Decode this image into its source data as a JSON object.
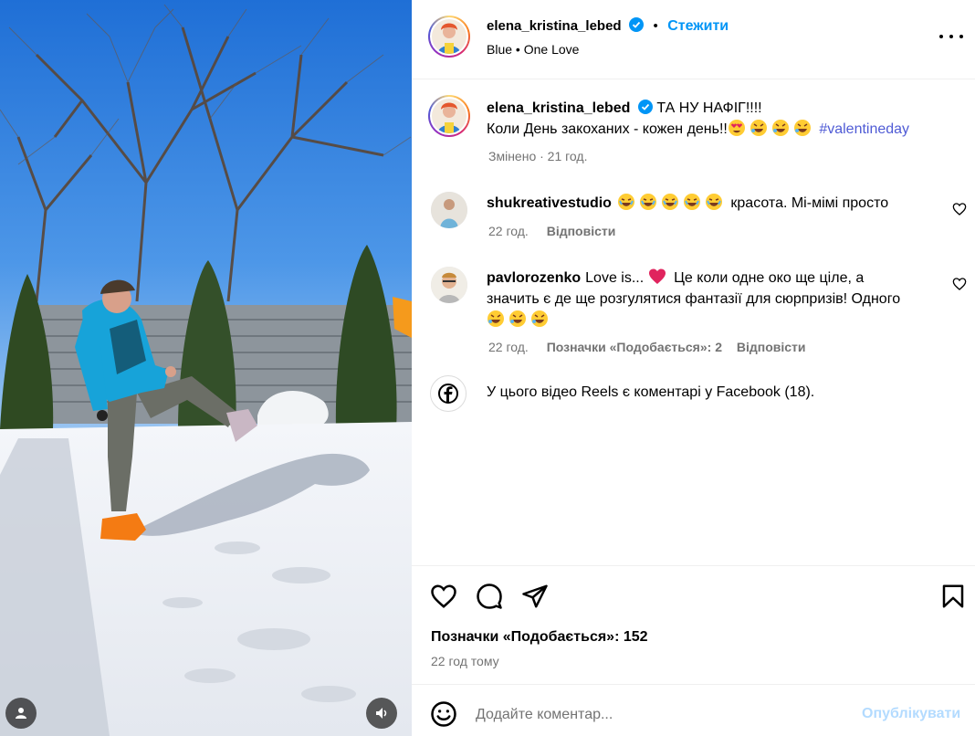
{
  "post": {
    "author": "elena_kristina_lebed",
    "follow_label": "Стежити",
    "audio_artist": "Blue",
    "audio_track": "One Love",
    "caption_line1": "ТА НУ НАФІГ!!!!",
    "caption_line2": "Коли День закоханих - кожен день!!",
    "hashtag": "#valentineday",
    "caption_meta": "Змінено · 21 год."
  },
  "comments": [
    {
      "user": "shukreativestudio",
      "text": "красота. Мі-мімі просто",
      "time": "22 год.",
      "reply_label": "Відповісти"
    },
    {
      "user": "pavlorozenko",
      "text_before_heart": "Love is...",
      "text_line1": "Це коли одне око ще ціле, а",
      "text_line2": "значить є де ще розгулятися фантазії для сюрпризів! Одного",
      "time": "22 год.",
      "likes_label": "Позначки «Подобається»: 2",
      "reply_label": "Відповісти"
    }
  ],
  "facebook_note": "У цього відео Reels є коментарі у Facebook (18).",
  "footer": {
    "likes": "Позначки «Подобається»: 152",
    "time": "22 год тому",
    "comment_placeholder": "Додайте коментар...",
    "publish_label": "Опублікувати"
  },
  "colors": {
    "link": "#0095f6",
    "hashtag": "#4f5bd5",
    "muted": "#737373",
    "publish_disabled": "#b3dbff"
  },
  "icons": [
    "verified-badge-icon",
    "more-options-icon",
    "like-icon",
    "comment-icon",
    "share-icon",
    "save-icon",
    "emoji-icon",
    "facebook-icon",
    "user-icon",
    "sound-icon"
  ]
}
